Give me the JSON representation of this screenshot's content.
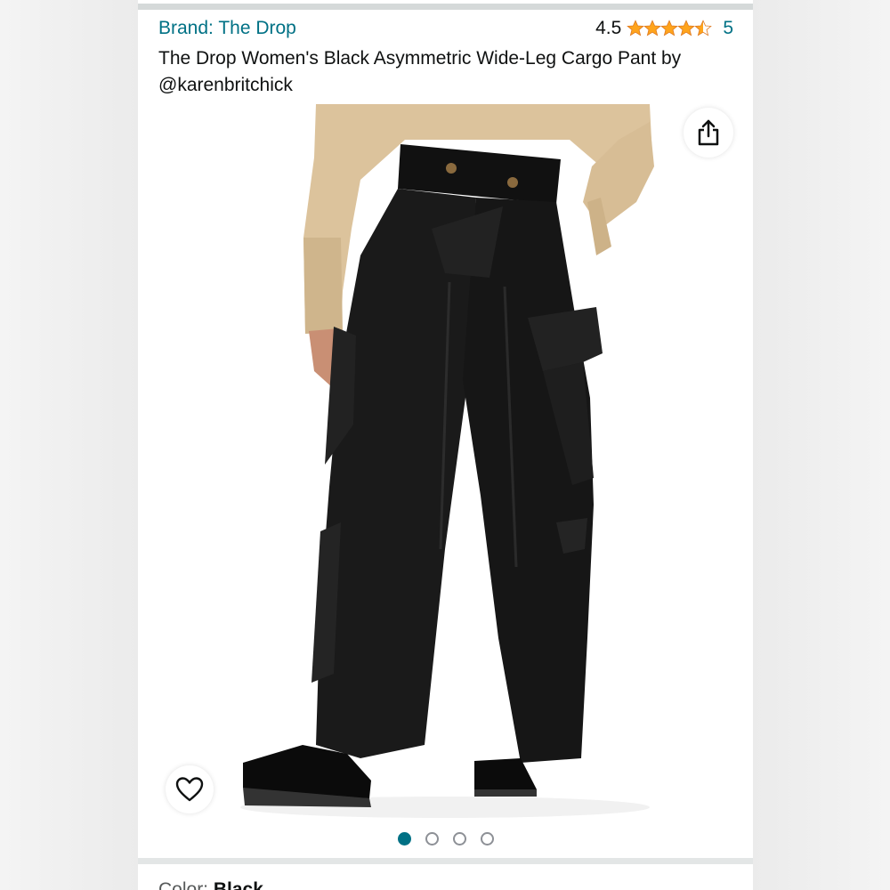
{
  "brand": {
    "label": "Brand: The Drop"
  },
  "rating": {
    "value": "4.5",
    "stars": 4.5,
    "count": "5",
    "star_color": "#ffa41c"
  },
  "product": {
    "title": "The Drop Women's Black Asymmetric Wide-Leg Cargo Pant by @karenbritchick"
  },
  "icons": {
    "share": "share-icon",
    "wishlist": "heart-outline-icon"
  },
  "carousel": {
    "total": 4,
    "active_index": 0
  },
  "color_selector": {
    "label": "Color:",
    "value": "Black"
  },
  "colors": {
    "link": "#007185",
    "text": "#0f1111",
    "accent": "#007185"
  }
}
